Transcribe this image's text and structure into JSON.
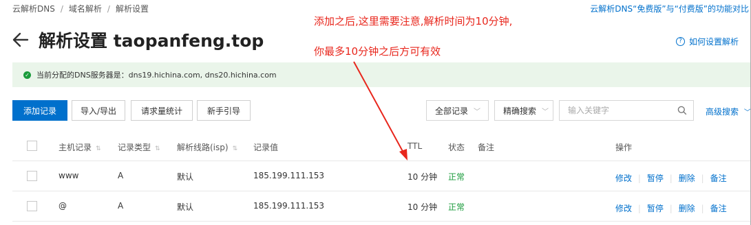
{
  "breadcrumb": [
    "云解析DNS",
    "域名解析",
    "解析设置"
  ],
  "top_link": "云解析DNS“免费版”与“付费版”的功能对比",
  "page_title": "解析设置 taopanfeng.top",
  "help_link": "如何设置解析",
  "info_bar": "当前分配的DNS服务器是：dns19.hichina.com, dns20.hichina.com",
  "toolbar": {
    "add_record": "添加记录",
    "import_export": "导入/导出",
    "request_stats": "请求量统计",
    "guide": "新手引导"
  },
  "filters": {
    "all_records": "全部记录",
    "exact_search": "精确搜索",
    "search_placeholder": "输入关键字",
    "advanced_search": "高级搜索"
  },
  "table": {
    "headers": {
      "host": "主机记录",
      "type": "记录类型",
      "line": "解析线路(isp)",
      "value": "记录值",
      "ttl": "TTL",
      "status": "状态",
      "remark": "备注",
      "actions": "操作"
    },
    "rows": [
      {
        "host": "www",
        "type": "A",
        "line": "默认",
        "value": "185.199.111.153",
        "ttl": "10 分钟",
        "status": "正常"
      },
      {
        "host": "@",
        "type": "A",
        "line": "默认",
        "value": "185.199.111.153",
        "ttl": "10 分钟",
        "status": "正常"
      }
    ],
    "actions": {
      "edit": "修改",
      "pause": "暂停",
      "delete": "删除",
      "remark": "备注"
    }
  },
  "annotation": {
    "line1": "添加之后,这里需要注意,解析时间为10分钟,",
    "line2": "你最多10分钟之后方可有效"
  },
  "colors": {
    "primary": "#0070cc",
    "success": "#1a9b3b",
    "annotation": "#e8261c",
    "info_bg": "#eaf5ea"
  }
}
